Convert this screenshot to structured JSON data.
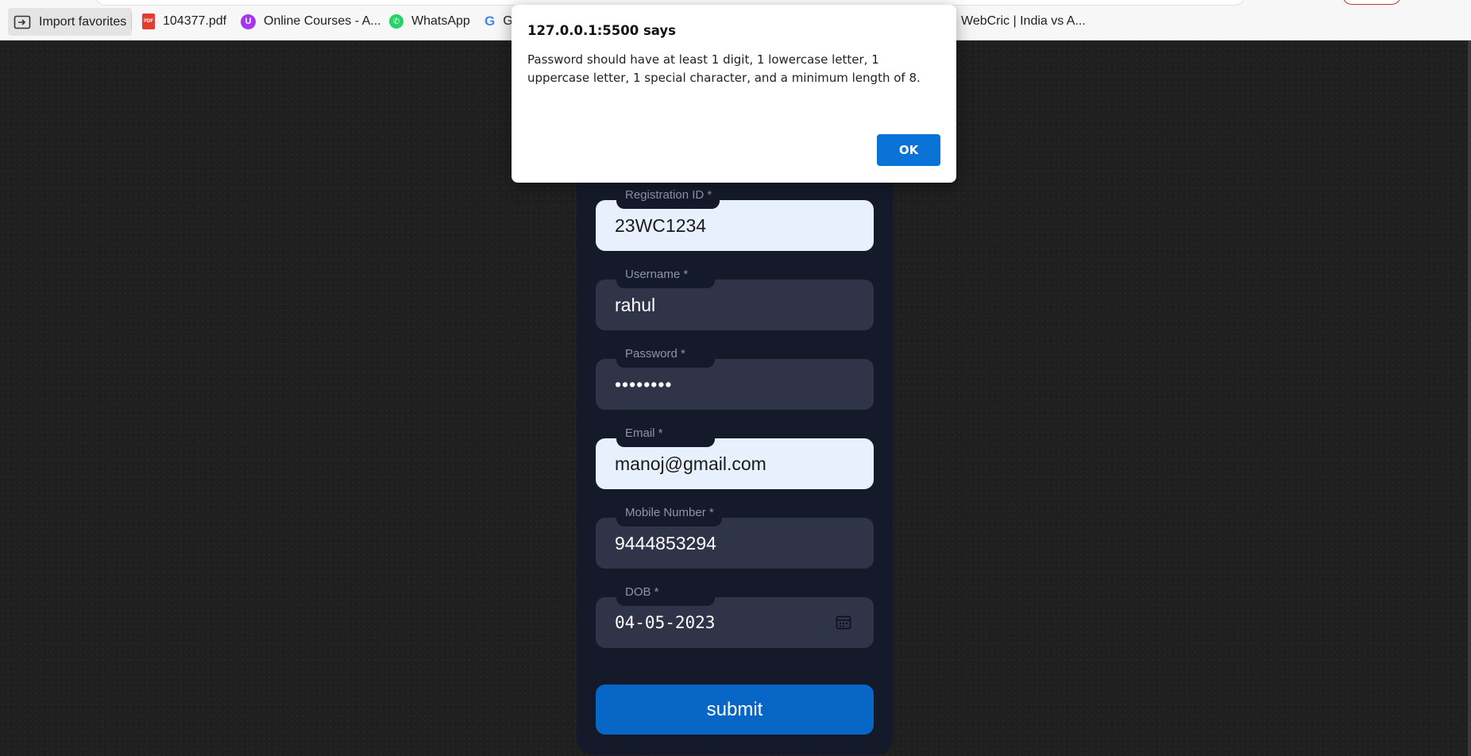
{
  "bookmarks": {
    "import_label": "Import favorites",
    "items": [
      {
        "label": "104377.pdf",
        "icon": "pdf-file-icon"
      },
      {
        "label": "Online Courses - A...",
        "icon": "udemy-icon"
      },
      {
        "label": "WhatsApp",
        "icon": "whatsapp-icon"
      },
      {
        "label": "G",
        "icon": "google-icon"
      },
      {
        "label": "WebCric | India vs A...",
        "icon": "webcric-icon"
      }
    ]
  },
  "dialog": {
    "title": "127.0.0.1:5500 says",
    "message": "Password should have at least 1 digit, 1 lowercase letter, 1 uppercase letter, 1 special character, and a minimum length of 8.",
    "ok_label": "OK"
  },
  "form": {
    "fields": {
      "registration_id": {
        "label": "Registration ID *",
        "value": "23WC1234"
      },
      "username": {
        "label": "Username *",
        "value": "rahul"
      },
      "password": {
        "label": "Password *",
        "value": "••••••••"
      },
      "email": {
        "label": "Email *",
        "value": "manoj@gmail.com"
      },
      "mobile": {
        "label": "Mobile Number *",
        "value": "9444853294"
      },
      "dob": {
        "label": "DOB *",
        "value": "04-05-2023"
      }
    },
    "submit_label": "submit"
  },
  "colors": {
    "page_background": "#1f1f1f",
    "form_card": "#151a2b",
    "input_background": "#2f3449",
    "autofill_background": "#e8f0fe",
    "submit_button": "#0866c6",
    "dialog_ok_button": "#0a73d8"
  }
}
